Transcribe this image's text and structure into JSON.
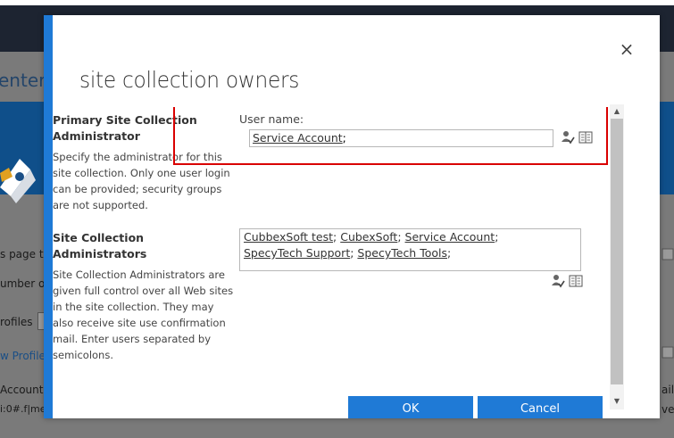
{
  "background": {
    "center_partial": "enter",
    "page_to_partial": "s page to",
    "number_partial": "umber o",
    "profiles_partial": "rofiles",
    "view_profile_partial": "w Profile",
    "account_partial": "Account",
    "claims_partial": "i:0#.f|me",
    "right_ail": "ail",
    "right_ve": "ve"
  },
  "dialog": {
    "close_symbol": "×",
    "title": "site collection owners",
    "primary": {
      "title": "Primary Site Collection Administrator",
      "description": "Specify the administrator for this site collection. Only one user login can be provided; security groups are not supported.",
      "user_name_label": "User name:",
      "value": "Service Account"
    },
    "admins": {
      "title": "Site Collection Administrators",
      "description": "Site Collection Administrators are given full control over all Web sites in the site collection. They may also receive site use confirmation mail. Enter users separated by semicolons.",
      "users": [
        "CubbexSoft test",
        "CubexSoft",
        "Service Account",
        "SpecyTech Support",
        "SpecyTech Tools"
      ]
    },
    "buttons": {
      "ok": "OK",
      "cancel": "Cancel"
    }
  },
  "icons": {
    "check_names": "check-names-icon",
    "browse": "address-book-icon",
    "close": "close-icon"
  },
  "colors": {
    "accent": "#1f7ad6",
    "highlight": "#d90000",
    "header": "#1d2431",
    "banner": "#0f4f8a"
  }
}
